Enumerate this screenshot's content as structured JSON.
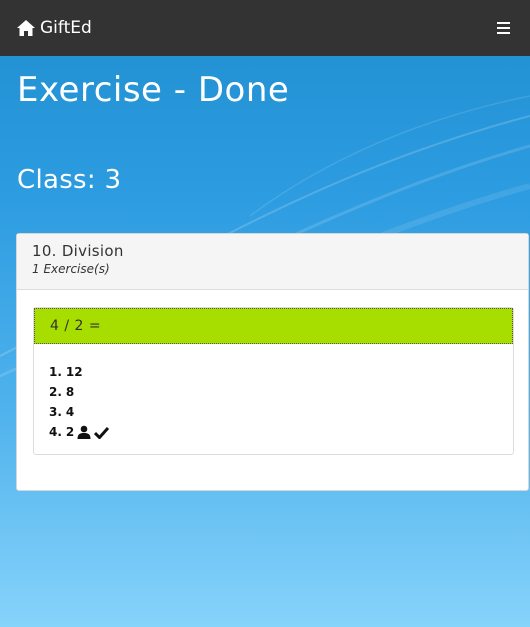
{
  "navbar": {
    "brand": "GiftEd",
    "brand_icon": "home-icon",
    "menu_icon": "hamburger-menu-icon"
  },
  "page": {
    "title": "Exercise - Done",
    "class_label": "Class: 3"
  },
  "panel": {
    "topic": "10. Division",
    "exercise_count": "1 Exercise(s)"
  },
  "exercise": {
    "question": "4 / 2 =",
    "answers": [
      {
        "num": "1.",
        "text": "12"
      },
      {
        "num": "2.",
        "text": "8"
      },
      {
        "num": "3.",
        "text": "4"
      },
      {
        "num": "4.",
        "text": "2",
        "icons": [
          "user-icon",
          "checkmark-icon"
        ]
      }
    ]
  },
  "colors": {
    "navbar": "#333333",
    "background_top": "#1f8fd0",
    "background_bottom": "#86d3fb",
    "question_bg": "#a8dd00"
  }
}
